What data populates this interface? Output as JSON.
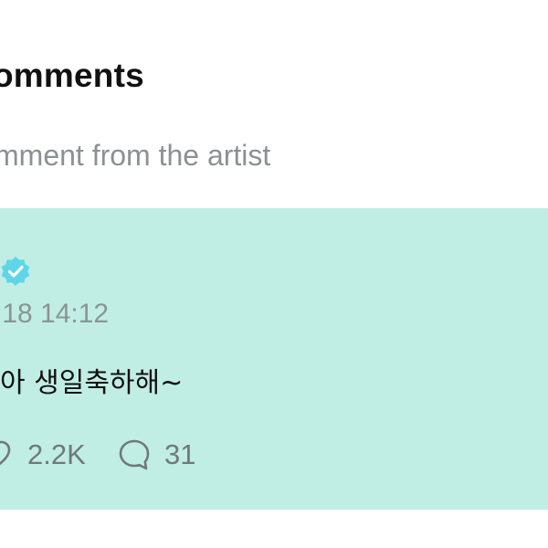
{
  "header": {
    "title": "omments",
    "subtitle": "mment from the artist"
  },
  "comment": {
    "timestamp": ".18 14:12",
    "text": "아 생일축하해~",
    "likes": "2.2K",
    "replies": "31"
  },
  "icons": {
    "verified": "verified-badge-icon",
    "like": "heart-outline-icon",
    "reply": "speech-bubble-icon"
  },
  "colors": {
    "card_background": "#c1eee4",
    "verified_badge": "#5fd6e8"
  }
}
